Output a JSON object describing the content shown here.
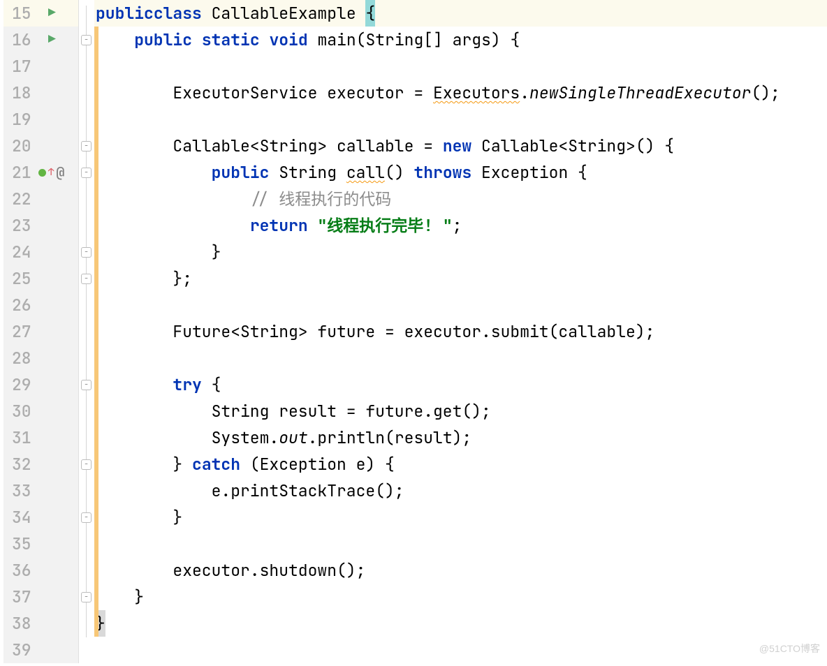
{
  "watermark": "@51CTO博客",
  "lines": [
    {
      "num": "15",
      "run": true,
      "hl": true
    },
    {
      "num": "16",
      "run": true
    },
    {
      "num": "17"
    },
    {
      "num": "18"
    },
    {
      "num": "19"
    },
    {
      "num": "20"
    },
    {
      "num": "21",
      "bookmark": true
    },
    {
      "num": "22"
    },
    {
      "num": "23"
    },
    {
      "num": "24"
    },
    {
      "num": "25"
    },
    {
      "num": "26"
    },
    {
      "num": "27"
    },
    {
      "num": "28"
    },
    {
      "num": "29"
    },
    {
      "num": "30"
    },
    {
      "num": "31"
    },
    {
      "num": "32"
    },
    {
      "num": "33"
    },
    {
      "num": "34"
    },
    {
      "num": "35"
    },
    {
      "num": "36"
    },
    {
      "num": "37"
    },
    {
      "num": "38"
    },
    {
      "num": "39"
    }
  ],
  "code": {
    "l15": {
      "k1": "public",
      "k2": "class",
      "name": " CallableExample ",
      "brace": "{"
    },
    "l16": {
      "indent": "    ",
      "k1": "public",
      "s": " ",
      "k2": "static",
      "s2": " ",
      "k3": "void",
      "rest": " main(String[] args) {"
    },
    "l18": {
      "indent": "        ",
      "p1": "ExecutorService executor = ",
      "wavy": "Executors",
      "dot": ".",
      "m": "newSingleThreadExecutor",
      "tail": "();"
    },
    "l20": {
      "indent": "        ",
      "p1": "Callable<String> callable = ",
      "kw": "new",
      "p2": " Callable<String>() {"
    },
    "l21": {
      "indent": "            ",
      "k1": "public",
      "p1": " String ",
      "wavy": "call",
      "p2": "() ",
      "k2": "throws",
      "p3": " Exception {"
    },
    "l22": {
      "indent": "                ",
      "cmt": "// 线程执行的代码"
    },
    "l23": {
      "indent": "                ",
      "k1": "return",
      "s": " ",
      "str": "\"线程执行完毕! \"",
      "tail": ";"
    },
    "l24": {
      "indent": "            ",
      "brace": "}"
    },
    "l25": {
      "indent": "        ",
      "brace": "};"
    },
    "l27": {
      "indent": "        ",
      "txt": "Future<String> future = executor.submit(callable);"
    },
    "l29": {
      "indent": "        ",
      "k1": "try",
      "p1": " {"
    },
    "l30": {
      "indent": "            ",
      "txt": "String result = future.get();"
    },
    "l31": {
      "indent": "            ",
      "p1": "System.",
      "m": "out",
      "p2": ".println(result);"
    },
    "l32": {
      "indent": "        ",
      "p1": "} ",
      "k1": "catch",
      "p2": " (Exception e) {"
    },
    "l33": {
      "indent": "            ",
      "txt": "e.printStackTrace();"
    },
    "l34": {
      "indent": "        ",
      "brace": "}"
    },
    "l36": {
      "indent": "        ",
      "txt": "executor.shutdown();"
    },
    "l37": {
      "indent": "    ",
      "brace": "}"
    },
    "l38": {
      "brace": "}"
    }
  }
}
